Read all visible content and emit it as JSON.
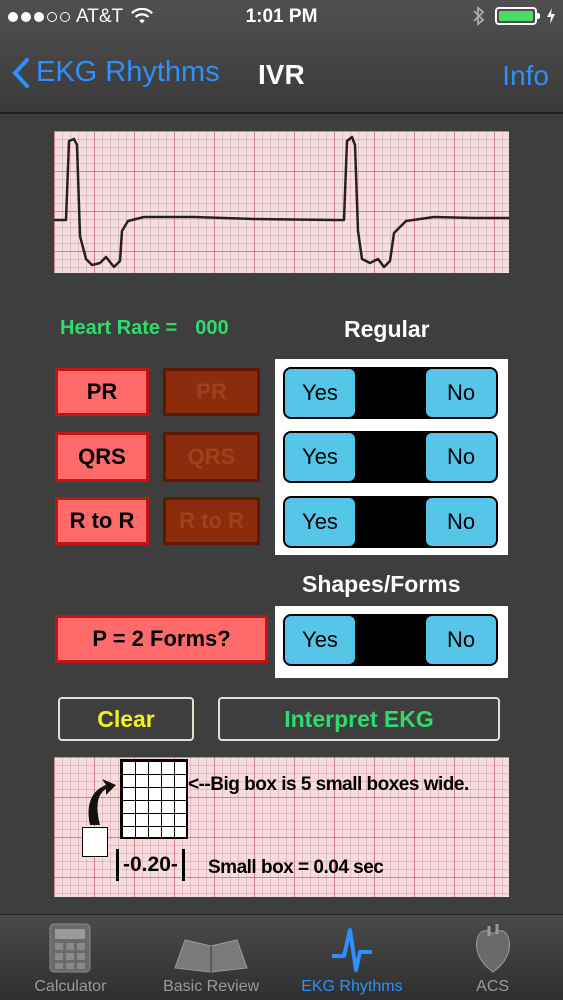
{
  "status_bar": {
    "carrier": "AT&T",
    "time": "1:01 PM",
    "signal_bars": 3,
    "battery_percent": 100
  },
  "nav": {
    "back_label": "EKG Rhythms",
    "title": "IVR",
    "info_label": "Info"
  },
  "heart_rate": {
    "label": "Heart Rate =",
    "value": "000"
  },
  "regular_section": {
    "title": "Regular",
    "rows": [
      {
        "label": "PR",
        "disabled_label": "PR",
        "yes": "Yes",
        "no": "No"
      },
      {
        "label": "QRS",
        "disabled_label": "QRS",
        "yes": "Yes",
        "no": "No"
      },
      {
        "label": "R to R",
        "disabled_label": "R to R",
        "yes": "Yes",
        "no": "No"
      }
    ]
  },
  "shapes_section": {
    "title": "Shapes/Forms",
    "row": {
      "label": "P = 2 Forms?",
      "yes": "Yes",
      "no": "No"
    }
  },
  "actions": {
    "clear": "Clear",
    "interpret": "Interpret EKG"
  },
  "legend": {
    "big_box_text": "<--Big box is 5 small boxes wide.",
    "duration": "0.20",
    "small_box_text": "Small box = 0.04 sec"
  },
  "tabs": [
    {
      "label": "Calculator",
      "icon": "calculator-icon",
      "active": false
    },
    {
      "label": "Basic Review",
      "icon": "book-icon",
      "active": false
    },
    {
      "label": "EKG Rhythms",
      "icon": "ekg-wave-icon",
      "active": true
    },
    {
      "label": "ACS",
      "icon": "heart-icon",
      "active": false
    }
  ],
  "colors": {
    "accent_blue": "#2e8fff",
    "heart_rate_green": "#2edc6c",
    "clear_yellow": "#f2f21e",
    "interpret_green": "#2edc6c",
    "toggle_cyan": "#55c5e8",
    "red_button": "#ff6b6b",
    "brown_button": "#8c2c0c"
  }
}
